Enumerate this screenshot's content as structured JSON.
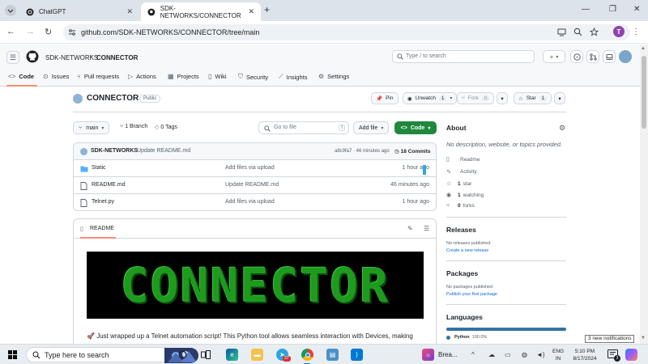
{
  "browser": {
    "tabs": [
      {
        "label": "ChatGPT"
      },
      {
        "label": "SDK-NETWORKS/CONNECTOR"
      }
    ],
    "url": "github.com/SDK-NETWORKS/CONNECTOR/tree/main",
    "profile_initial": "T"
  },
  "header": {
    "owner": "SDK-NETWORKS",
    "separator": "/",
    "repo": "CONNECTOR",
    "search_placeholder": "Type / to search",
    "plus": "+"
  },
  "repo_nav": [
    {
      "label": "Code"
    },
    {
      "label": "Issues"
    },
    {
      "label": "Pull requests"
    },
    {
      "label": "Actions"
    },
    {
      "label": "Projects"
    },
    {
      "label": "Wiki"
    },
    {
      "label": "Security"
    },
    {
      "label": "Insights"
    },
    {
      "label": "Settings"
    }
  ],
  "repo": {
    "title": "CONNECTOR",
    "visibility": "Public",
    "pin": "Pin",
    "unwatch": "Unwatch",
    "watch_count": "1",
    "fork": "Fork",
    "fork_count": "0",
    "star": "Star",
    "star_count": "1"
  },
  "controls": {
    "branch": "main",
    "branches": "1 Branch",
    "tags": "0 Tags",
    "go_to_file": "Go to file",
    "shortcut": "t",
    "add_file": "Add file",
    "code": "Code"
  },
  "commit": {
    "author": "SDK-NETWORKS",
    "message": "Update README.md",
    "meta": "a8c9fa7 · 46 minutes ago",
    "count": "18 Commits"
  },
  "files": [
    {
      "name": "Static",
      "message": "Add files via upload",
      "time": "1 hour ago",
      "type": "folder"
    },
    {
      "name": "README.md",
      "message": "Update README.md",
      "time": "46 minutes ago",
      "type": "file"
    },
    {
      "name": "Telnet.py",
      "message": "Add files via upload",
      "time": "1 hour ago",
      "type": "file"
    }
  ],
  "readme": {
    "tab": "README",
    "banner": "CONNECTOR",
    "body": "Just wrapped up a Telnet automation script! This Python tool allows seamless interaction with Devices, making"
  },
  "about": {
    "heading": "About",
    "description": "No description, website, or topics provided.",
    "items": [
      {
        "count": "",
        "label": "Readme"
      },
      {
        "count": "",
        "label": "Activity"
      },
      {
        "count": "1",
        "label": "star"
      },
      {
        "count": "1",
        "label": "watching"
      },
      {
        "count": "0",
        "label": "forks"
      }
    ]
  },
  "releases": {
    "heading": "Releases",
    "empty": "No releases published",
    "link": "Create a new release"
  },
  "packages": {
    "heading": "Packages",
    "empty": "No packages published",
    "link": "Publish your first package"
  },
  "languages": {
    "heading": "Languages",
    "items": [
      {
        "name": "Python",
        "percent": "100.0%"
      }
    ]
  },
  "notification_tip": "3 new notifications",
  "taskbar": {
    "search_placeholder": "Type here to search",
    "app_label": "Brea...",
    "badge": "37",
    "lang_top": "ENG",
    "lang_bottom": "IN",
    "time": "5:10 PM",
    "date": "8/17/2024",
    "notif_count": "3"
  }
}
